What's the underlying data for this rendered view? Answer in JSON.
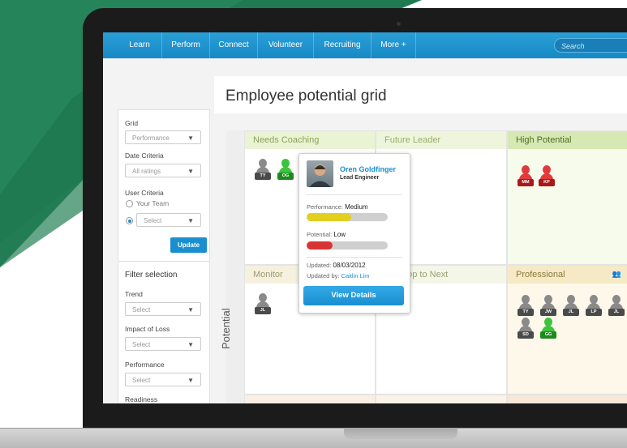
{
  "colors": {
    "nav": "#1a8fd0",
    "accent": "#1a8fd0",
    "bg_green": "#1f7a52",
    "needs_coaching": "#eaf3d4",
    "high_potential": "#d6e9b4",
    "professional": "#f5e9c6",
    "mid_bottom": "#f8e8d8"
  },
  "nav": {
    "items": [
      "Learn",
      "Perform",
      "Connect",
      "Volunteer",
      "Recruiting",
      "More +"
    ],
    "search_placeholder": "Search"
  },
  "page": {
    "title": "Employee potential grid"
  },
  "sidebar": {
    "grid_label": "Grid",
    "grid_value": "Performance",
    "date_label": "Date Criteria",
    "date_value": "All ratings",
    "user_label": "User Criteria",
    "radio_team": "Your Team",
    "radio_select": "Select",
    "update": "Update",
    "filter_title": "Filter selection",
    "trend_label": "Trend",
    "trend_value": "Select",
    "impact_label": "Impact of Loss",
    "impact_value": "Select",
    "performance_label": "Performance",
    "performance_value": "Select",
    "readiness_label": "Readiness"
  },
  "grid": {
    "axis_label": "Potential",
    "cells": {
      "needs_coaching": "Needs Coaching",
      "future_leader": "Future Leader",
      "high_potential": "High Potential",
      "monitor": "Monitor",
      "develop_to_next": "Develop to Next",
      "professional": "Professional"
    },
    "avatars": {
      "needs_coaching": [
        "TY",
        "OG"
      ],
      "high_potential": [
        "MM",
        "KP"
      ],
      "monitor": [
        "JL"
      ],
      "professional_row1": [
        "TY",
        "JW",
        "JL",
        "LP",
        "JL"
      ],
      "professional_row2": [
        "SD",
        "GG"
      ]
    }
  },
  "popup": {
    "name": "Oren Goldfinger",
    "role": "Lead Engineer",
    "performance_label": "Performance:",
    "performance_value": "Medium",
    "performance_level": 0.55,
    "potential_label": "Potential:",
    "potential_value": "Low",
    "potential_level": 0.32,
    "updated_label": "Updated:",
    "updated_value": "08/03/2012",
    "updated_by_label": "Updated by:",
    "updated_by_value": "Caitlin Lim",
    "view_details": "View Details"
  }
}
